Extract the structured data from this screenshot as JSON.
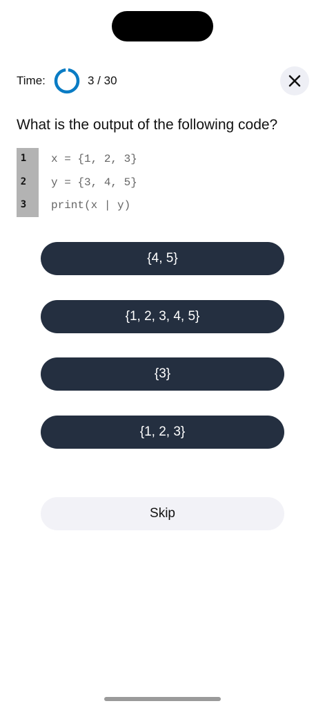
{
  "header": {
    "time_label": "Time:",
    "progress": "3 / 30",
    "timer_icon": "timer-ring-icon",
    "close_icon": "close-icon",
    "accent_color": "#0a7cc4"
  },
  "question": {
    "text": "What is the output of the following code?"
  },
  "code": {
    "lines": [
      {
        "number": "1",
        "text": "x = {1, 2, 3}"
      },
      {
        "number": "2",
        "text": "y = {3, 4, 5}"
      },
      {
        "number": "3",
        "text": "print(x | y)"
      }
    ]
  },
  "options": [
    {
      "label": "{4, 5}"
    },
    {
      "label": "{1, 2, 3, 4, 5}"
    },
    {
      "label": "{3}"
    },
    {
      "label": "{1, 2, 3}"
    }
  ],
  "skip": {
    "label": "Skip"
  },
  "colors": {
    "option_bg": "#242f40",
    "skip_bg": "#f2f2f7",
    "close_bg": "#eeeff5"
  }
}
